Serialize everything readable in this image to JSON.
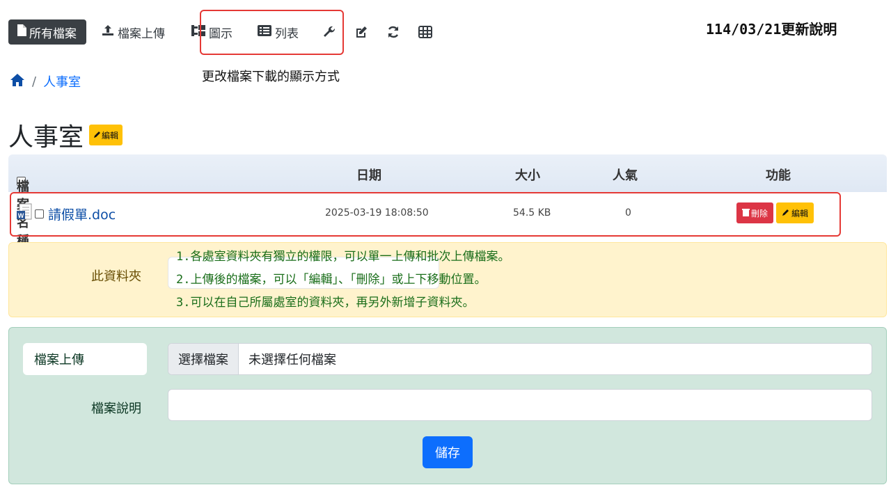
{
  "toolbar": {
    "all_files_label": "所有檔案",
    "upload_label": "檔案上傳",
    "icon_view_label": "圖示",
    "list_view_label": "列表",
    "extra_icons": [
      "wrench-icon",
      "edit-square-icon",
      "refresh-icon",
      "table-grid-icon"
    ]
  },
  "annotations": {
    "top_right": "114/03/21更新說明",
    "view_mode_note": "更改檔案下載的顯示方式",
    "notes": [
      "1.各處室資料夾有獨立的權限，可以單一上傳和批次上傳檔案。",
      "2.上傳後的檔案，可以「編輯」、「刪除」或上下移動位置。",
      "3.可以在自己所屬處室的資料夾，再另外新增子資料夾。"
    ]
  },
  "breadcrumb": {
    "home_icon": "home-icon",
    "separator": "/",
    "current": "人事室"
  },
  "page": {
    "title": "人事室",
    "edit_label": "編輯"
  },
  "table": {
    "headers": {
      "name": "檔案名稱",
      "date": "日期",
      "size": "大小",
      "popularity": "人氣",
      "actions": "功能"
    },
    "rows": [
      {
        "name": "請假單.doc",
        "date": "2025-03-19 18:08:50",
        "size": "54.5 KB",
        "popularity": "0",
        "delete_label": "刪除",
        "edit_label": "編輯"
      }
    ]
  },
  "folder": {
    "label": "此資料夾"
  },
  "upload": {
    "label": "檔案上傳",
    "choose_label": "選擇檔案",
    "status": "未選擇任何檔案",
    "desc_label": "檔案說明",
    "save_label": "儲存"
  },
  "colors": {
    "accent": "#0d6efd",
    "danger": "#dc3545",
    "warning": "#ffc107",
    "annotation_red": "#e53935",
    "note_green": "#1a6e1a"
  }
}
